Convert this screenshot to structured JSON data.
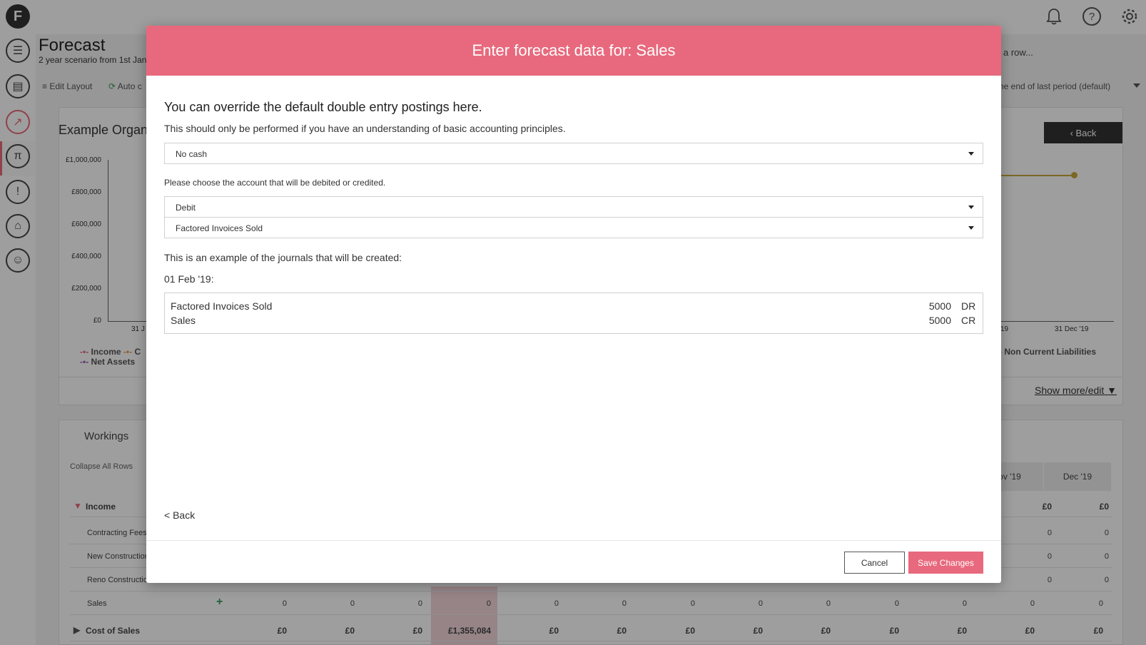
{
  "app": {
    "page_title": "Forecast",
    "subtitle": "2 year scenario from 1st Jan",
    "edit_layout": "Edit Layout",
    "auto_label": "Auto c",
    "row_hint": "a row...",
    "period_select": "he end of last period (default)",
    "org_title": "Example Organ",
    "back_button": "Back",
    "show_more": "Show more/edit",
    "workings": "Workings",
    "collapse_all": "Collapse All Rows"
  },
  "chart_data": {
    "type": "line",
    "yticks": [
      "£1,000,000",
      "£800,000",
      "£600,000",
      "£400,000",
      "£200,000",
      "£0"
    ],
    "xticks": [
      "31 J",
      "19",
      "31 Dec '19"
    ],
    "legend": [
      "Income",
      "C",
      "Net Assets",
      "Non Current Liabilities"
    ],
    "series_colors": {
      "income": "#e8697d",
      "net_assets": "#9b59b6",
      "gold": "#c9a93a"
    }
  },
  "grid": {
    "months": [
      "ov '19",
      "Dec '19"
    ],
    "rows": [
      {
        "label": "Income",
        "bold": true,
        "values": [
          "£0",
          "£0"
        ]
      },
      {
        "label": "Contracting Fees",
        "values": [
          "0",
          "0"
        ]
      },
      {
        "label": "New Construction",
        "values": [
          "0",
          "0"
        ]
      },
      {
        "label": "Reno Construction",
        "values": [
          "0",
          "0"
        ]
      },
      {
        "label": "Sales",
        "values": [
          "0",
          "0",
          "0",
          "0",
          "0",
          "0",
          "0",
          "0",
          "0",
          "0",
          "0",
          "0",
          "0"
        ]
      },
      {
        "label": "Cost of Sales",
        "bold": true,
        "values": [
          "£0",
          "£0",
          "£0",
          "£1,355,084",
          "£0",
          "£0",
          "£0",
          "£0",
          "£0",
          "£0",
          "£0",
          "£0",
          "£0"
        ]
      }
    ]
  },
  "modal": {
    "title": "Enter forecast data for: Sales",
    "heading": "You can override the default double entry postings here.",
    "note": "This should only be performed if you have an understanding of basic accounting principles.",
    "cash_select": "No cash",
    "choose_label": "Please choose the account that will be debited or credited.",
    "direction_select": "Debit",
    "account_select": "Factored Invoices Sold",
    "example_label": "This is an example of the journals that will be created:",
    "journal_date": "01 Feb '19:",
    "journals": [
      {
        "account": "Factored Invoices Sold",
        "amount": "5000",
        "side": "DR"
      },
      {
        "account": "Sales",
        "amount": "5000",
        "side": "CR"
      }
    ],
    "back_link": "< Back",
    "cancel": "Cancel",
    "save": "Save Changes"
  },
  "colors": {
    "accent": "#e8697d"
  }
}
